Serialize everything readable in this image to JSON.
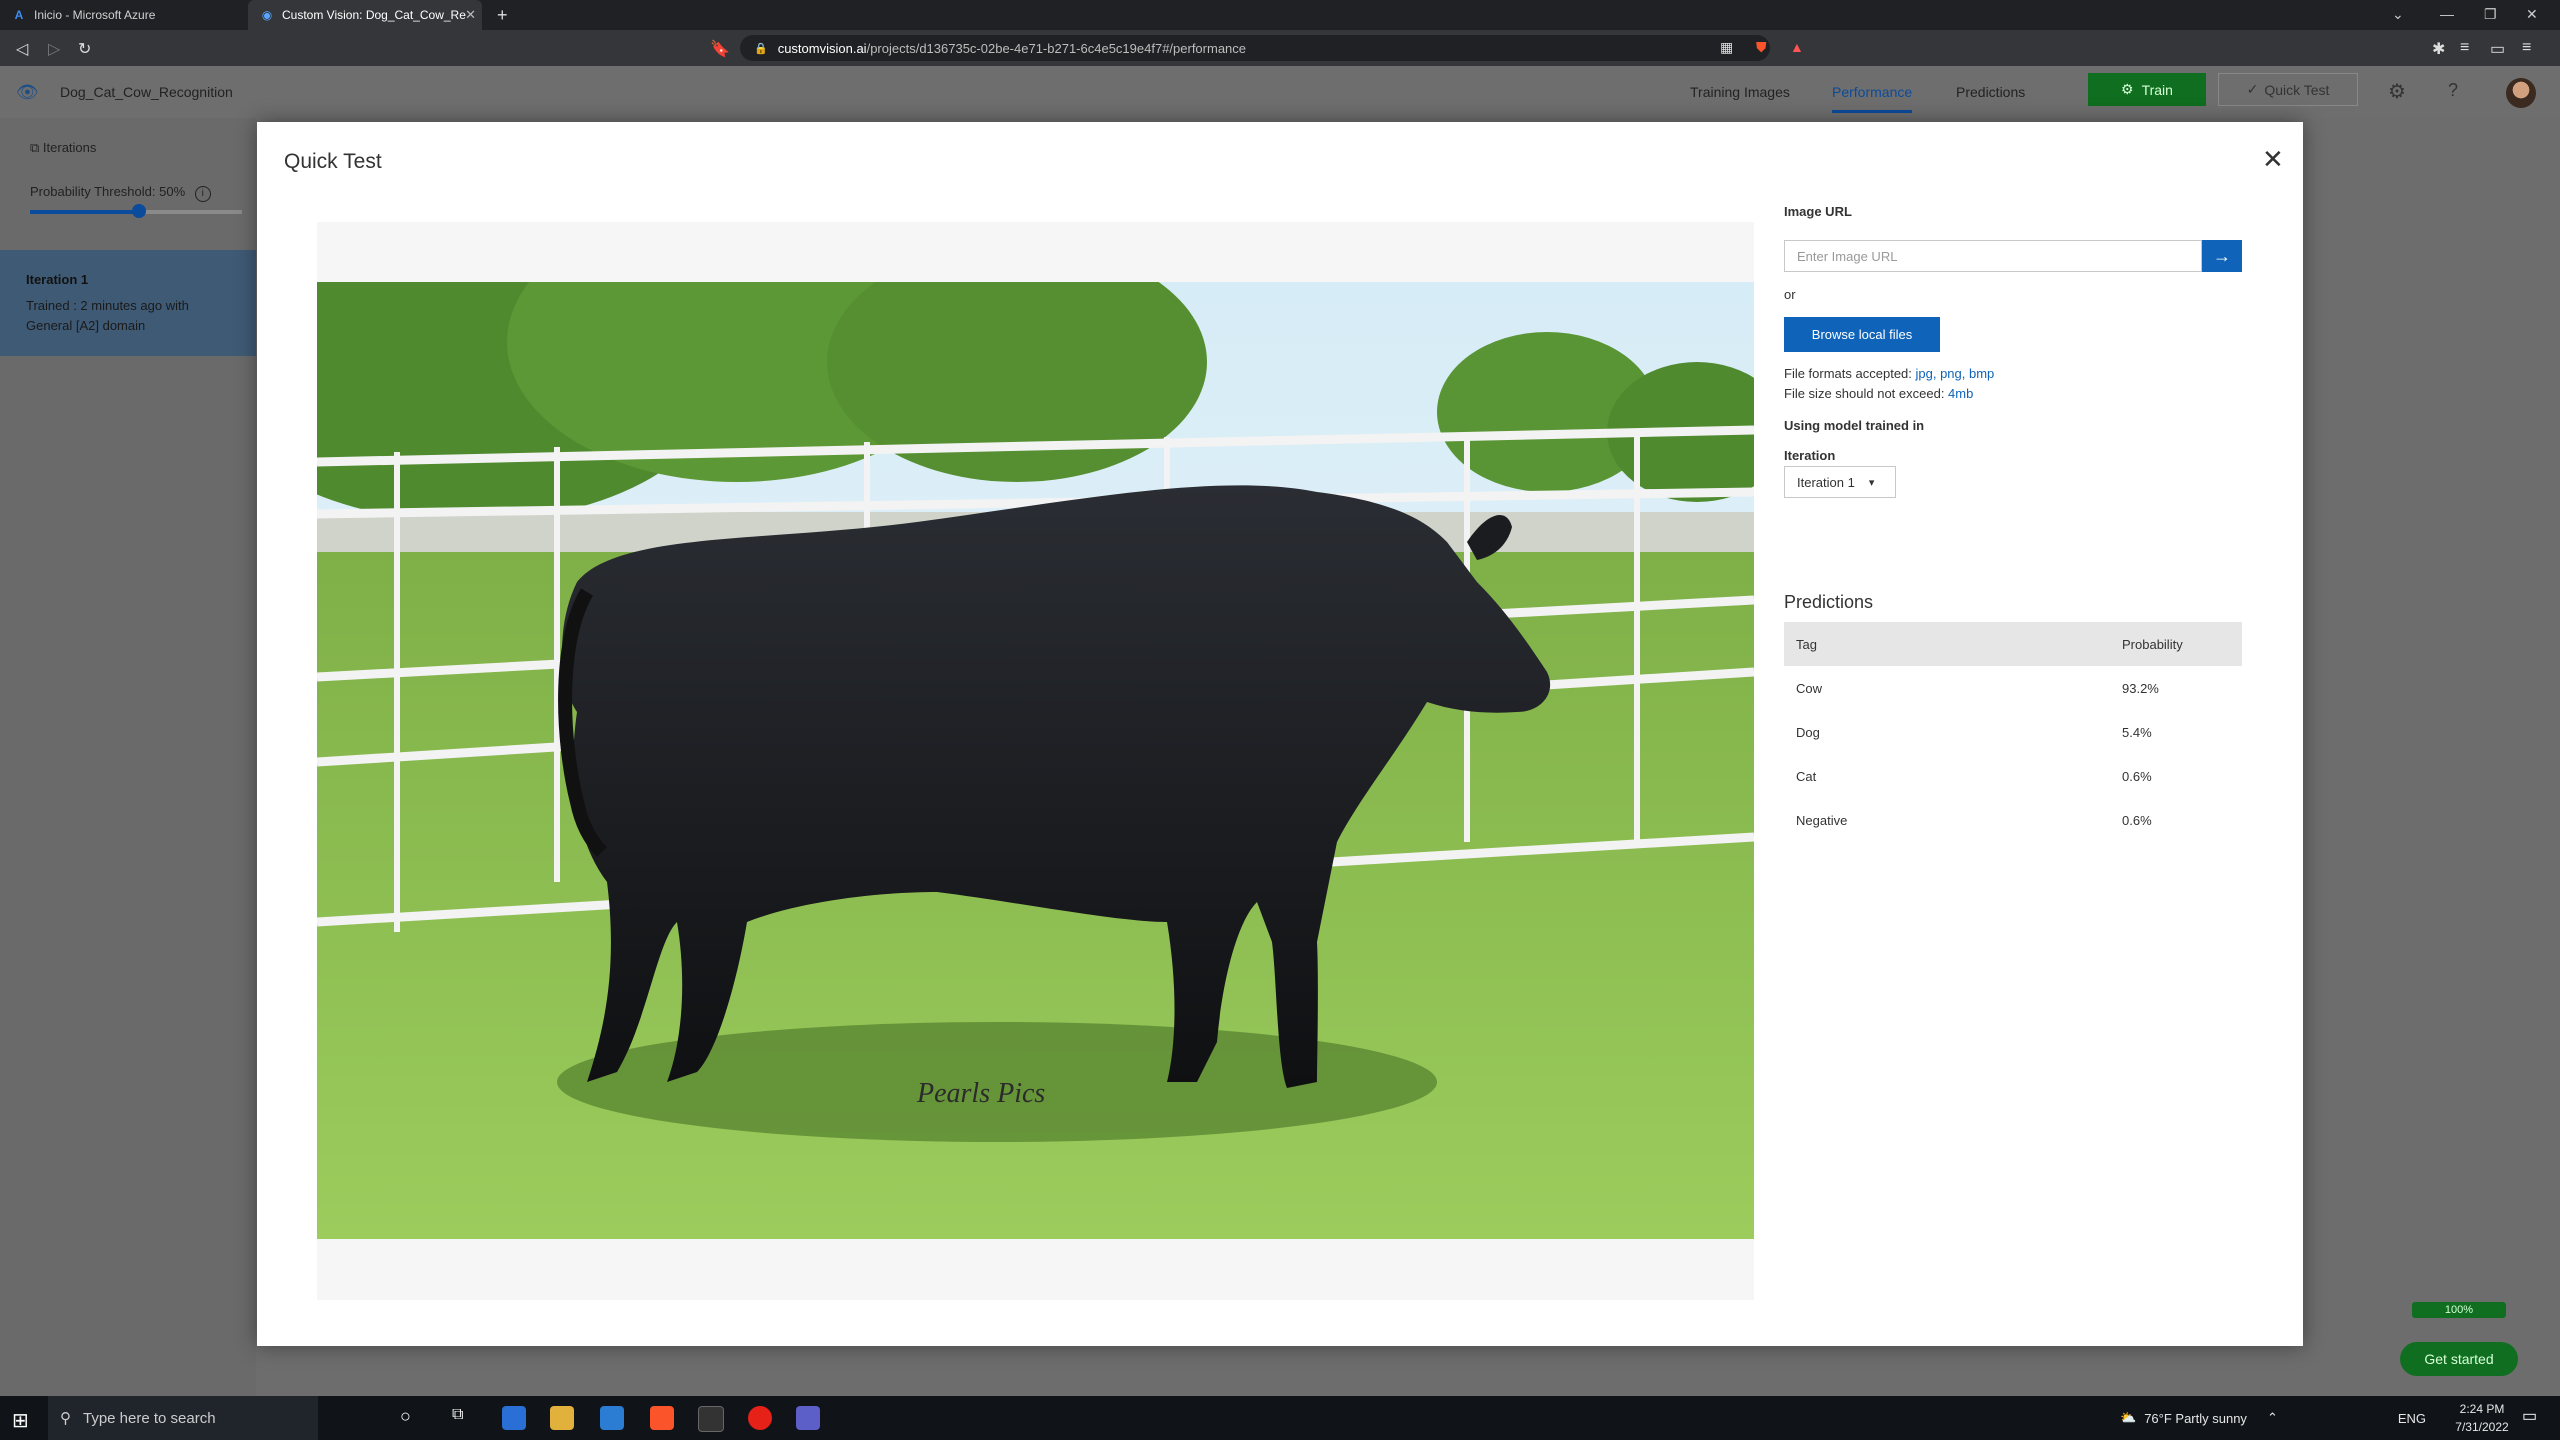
{
  "browser": {
    "tabs": [
      {
        "title": "Inicio - Microsoft Azure",
        "icon": "azure-icon"
      },
      {
        "title": "Custom Vision: Dog_Cat_Cow_Re",
        "icon": "custom-vision-icon"
      }
    ],
    "url_host": "customvision.ai",
    "url_path": "/projects/d136735c-02be-4e71-b271-6c4e5c19e4f7#/performance"
  },
  "app": {
    "project_name": "Dog_Cat_Cow_Recognition",
    "nav": [
      "Training Images",
      "Performance",
      "Predictions"
    ],
    "active_nav": "Performance",
    "train_label": "Train",
    "quick_test_label": "Quick Test",
    "sidebar": {
      "iterations_label": "Iterations",
      "threshold_label": "Probability Threshold: 50%",
      "threshold_value": 0.5,
      "iteration": {
        "title": "Iteration 1",
        "desc": "Trained : 2 minutes ago with General [A2] domain"
      }
    }
  },
  "modal": {
    "title": "Quick Test",
    "image_url_label": "Image URL",
    "image_url_placeholder": "Enter Image URL",
    "or_label": "or",
    "browse_label": "Browse local files",
    "formats_prefix": "File formats accepted: ",
    "formats": "jpg, png, bmp",
    "size_prefix": "File size should not exceed: ",
    "size_limit": "4mb",
    "using_model_label": "Using model trained in",
    "iteration_label": "Iteration",
    "iteration_value": "Iteration 1",
    "watermark": "Pearls Pics",
    "predictions_title": "Predictions",
    "predictions_header": {
      "tag": "Tag",
      "probability": "Probability"
    },
    "predictions": [
      {
        "tag": "Cow",
        "probability": "93.2%"
      },
      {
        "tag": "Dog",
        "probability": "5.4%"
      },
      {
        "tag": "Cat",
        "probability": "0.6%"
      },
      {
        "tag": "Negative",
        "probability": "0.6%"
      }
    ]
  },
  "widgets": {
    "progress": "100%",
    "progress_value": 1.0,
    "get_started": "Get started"
  },
  "taskbar": {
    "search_placeholder": "Type here to search",
    "weather": "76°F  Partly sunny",
    "lang": "ENG",
    "time": "2:24 PM",
    "date": "7/31/2022"
  },
  "colors": {
    "accent_blue": "#0f64b9",
    "train_green": "#0f6e1f",
    "nav_active": "#0b4b9b"
  }
}
